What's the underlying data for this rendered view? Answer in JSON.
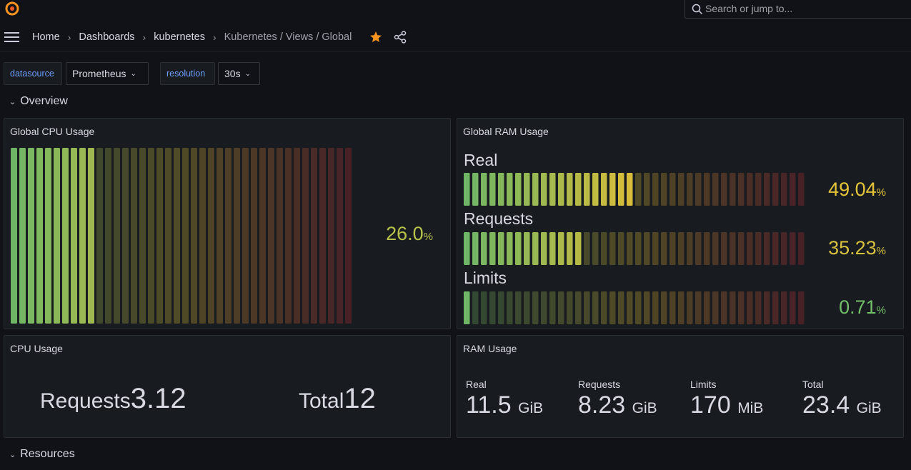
{
  "topbar": {
    "search_placeholder": "Search or jump to..."
  },
  "breadcrumbs": [
    "Home",
    "Dashboards",
    "kubernetes",
    "Kubernetes / Views / Global"
  ],
  "variables": {
    "datasource_label": "datasource",
    "datasource_value": "Prometheus",
    "resolution_label": "resolution",
    "resolution_value": "30s"
  },
  "rows": {
    "overview": "Overview",
    "resources": "Resources"
  },
  "panels": {
    "global_cpu": {
      "title": "Global CPU Usage",
      "value": "26.0",
      "unit": "%",
      "fraction": 0.26,
      "value_color": "#b8c34a"
    },
    "global_ram": {
      "title": "Global RAM Usage",
      "gauges": [
        {
          "label": "Real",
          "value": "49.04",
          "unit": "%",
          "fraction": 0.4904,
          "value_color": "#e4c53a"
        },
        {
          "label": "Requests",
          "value": "35.23",
          "unit": "%",
          "fraction": 0.3523,
          "value_color": "#d6c23e"
        },
        {
          "label": "Limits",
          "value": "0.71",
          "unit": "%",
          "fraction": 0.0071,
          "value_color": "#73bf69"
        }
      ]
    },
    "cpu_usage": {
      "title": "CPU Usage",
      "stats": [
        {
          "label": "Requests",
          "value": "3.12"
        },
        {
          "label": "Total",
          "value": "12"
        }
      ]
    },
    "ram_usage": {
      "title": "RAM Usage",
      "stats": [
        {
          "label": "Real",
          "value": "11.5",
          "unit": "GiB"
        },
        {
          "label": "Requests",
          "value": "8.23",
          "unit": "GiB"
        },
        {
          "label": "Limits",
          "value": "170",
          "unit": "MiB"
        },
        {
          "label": "Total",
          "value": "23.4",
          "unit": "GiB"
        }
      ]
    }
  },
  "colors": {
    "accent_orange": "#f7931e",
    "link_blue": "#6e9fff",
    "gauge_green": "#73bf69",
    "gauge_yellow": "#e4c53a",
    "gauge_red": "#c4343c"
  },
  "icons": [
    "grafana-logo-icon",
    "search-icon",
    "hamburger-menu-icon",
    "star-icon",
    "share-icon",
    "chevron-down-icon"
  ]
}
